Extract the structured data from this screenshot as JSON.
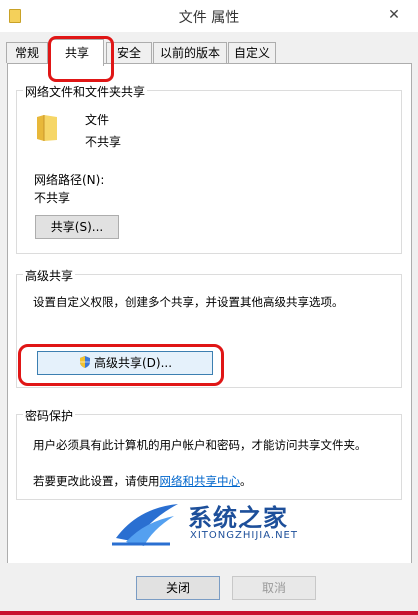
{
  "window": {
    "title": "文件 属性",
    "close_glyph": "✕"
  },
  "tabs": [
    {
      "label": "常规"
    },
    {
      "label": "共享"
    },
    {
      "label": "安全"
    },
    {
      "label": "以前的版本"
    },
    {
      "label": "自定义"
    }
  ],
  "network_sharing": {
    "group_title": "网络文件和文件夹共享",
    "item_name": "文件",
    "item_status": "不共享",
    "path_label": "网络路径(N):",
    "path_value": "不共享",
    "share_button": "共享(S)..."
  },
  "advanced_sharing": {
    "group_title": "高级共享",
    "description": "设置自定义权限，创建多个共享，并设置其他高级共享选项。",
    "button": "高级共享(D)..."
  },
  "password_protection": {
    "group_title": "密码保护",
    "description": "用户必须具有此计算机的用户帐户和密码，才能访问共享文件夹。",
    "change_prefix": "若要更改此设置，请使用",
    "link": "网络和共享中心",
    "change_suffix": "。"
  },
  "watermark": {
    "text": "系统之家",
    "sub": "XITONGZHIJIA.NET"
  },
  "footer": {
    "close_button": "关闭",
    "cancel_button": "取消"
  },
  "colors": {
    "highlight_red": "#e01616",
    "link": "#0066cc"
  }
}
